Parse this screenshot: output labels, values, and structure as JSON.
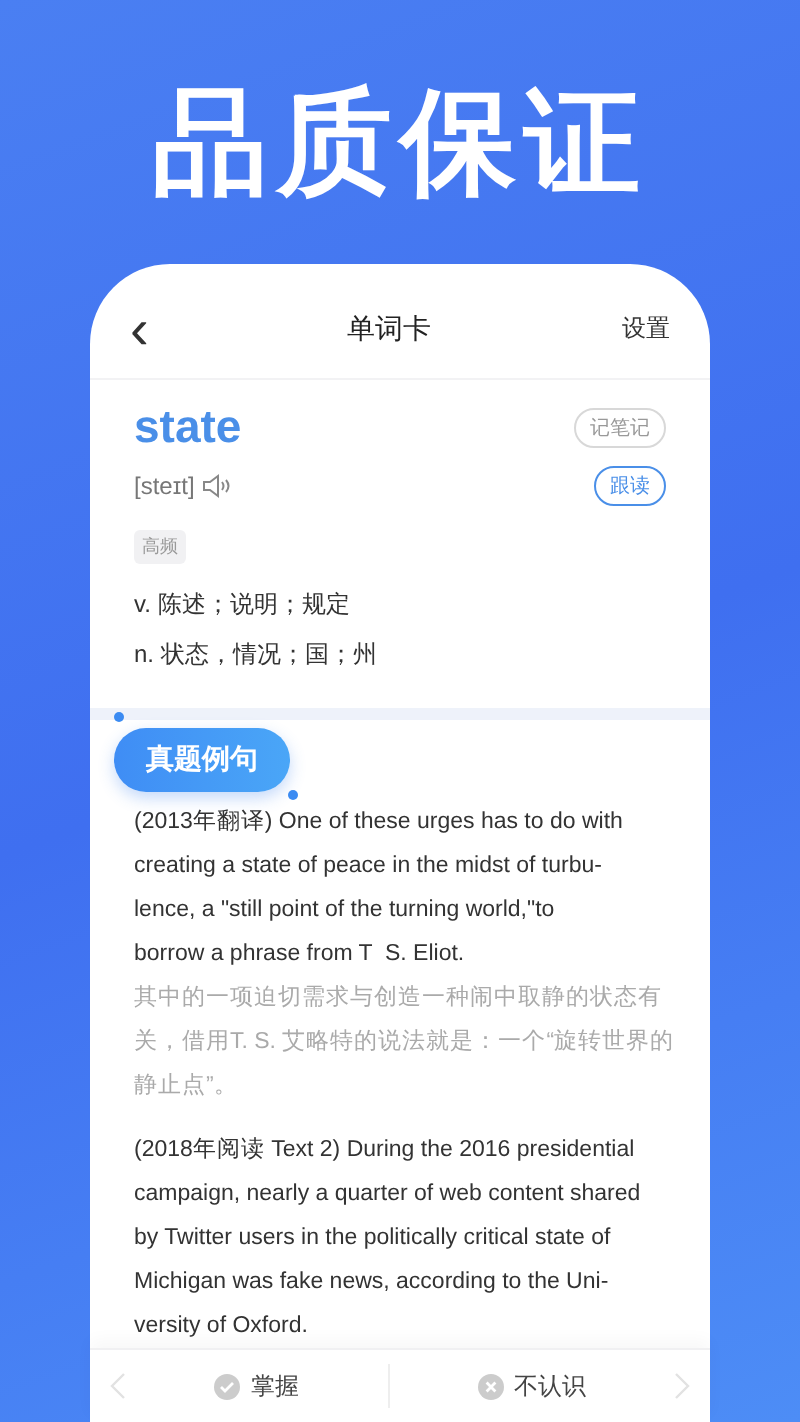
{
  "headline": "品质保证",
  "nav": {
    "back": "‹",
    "title": "单词卡",
    "settings": "设置"
  },
  "word": {
    "text": "state",
    "phonetic": "[steɪt]",
    "note_button": "记笔记",
    "follow_button": "跟读",
    "tag": "高频"
  },
  "definitions": [
    "v. 陈述；说明；规定",
    "n. 状态，情况；国；州"
  ],
  "section_badge": "真题例句",
  "examples": [
    {
      "english": [
        "(2013年翻译) One of these urges has to do with",
        "creating a state of peace in the midst of turbu-",
        "lence, a \"still point of the turning world,\"to",
        "borrow a phrase from T  S. Eliot."
      ],
      "chinese": [
        "其中的一项迫切需求与创造一种闹中取静的状态有",
        "关，借用T. S. 艾略特的说法就是：一个“旋转世界的",
        "静止点”。"
      ]
    },
    {
      "english": [
        "(2018年阅读 Text 2) During the 2016 presidential",
        "campaign, nearly a quarter of web content shared",
        "by Twitter users in the politically critical state of",
        "Michigan was fake news, according to the Uni-",
        "versity of Oxford."
      ]
    }
  ],
  "bottom_bar": {
    "know": "掌握",
    "unknown": "不认识"
  }
}
